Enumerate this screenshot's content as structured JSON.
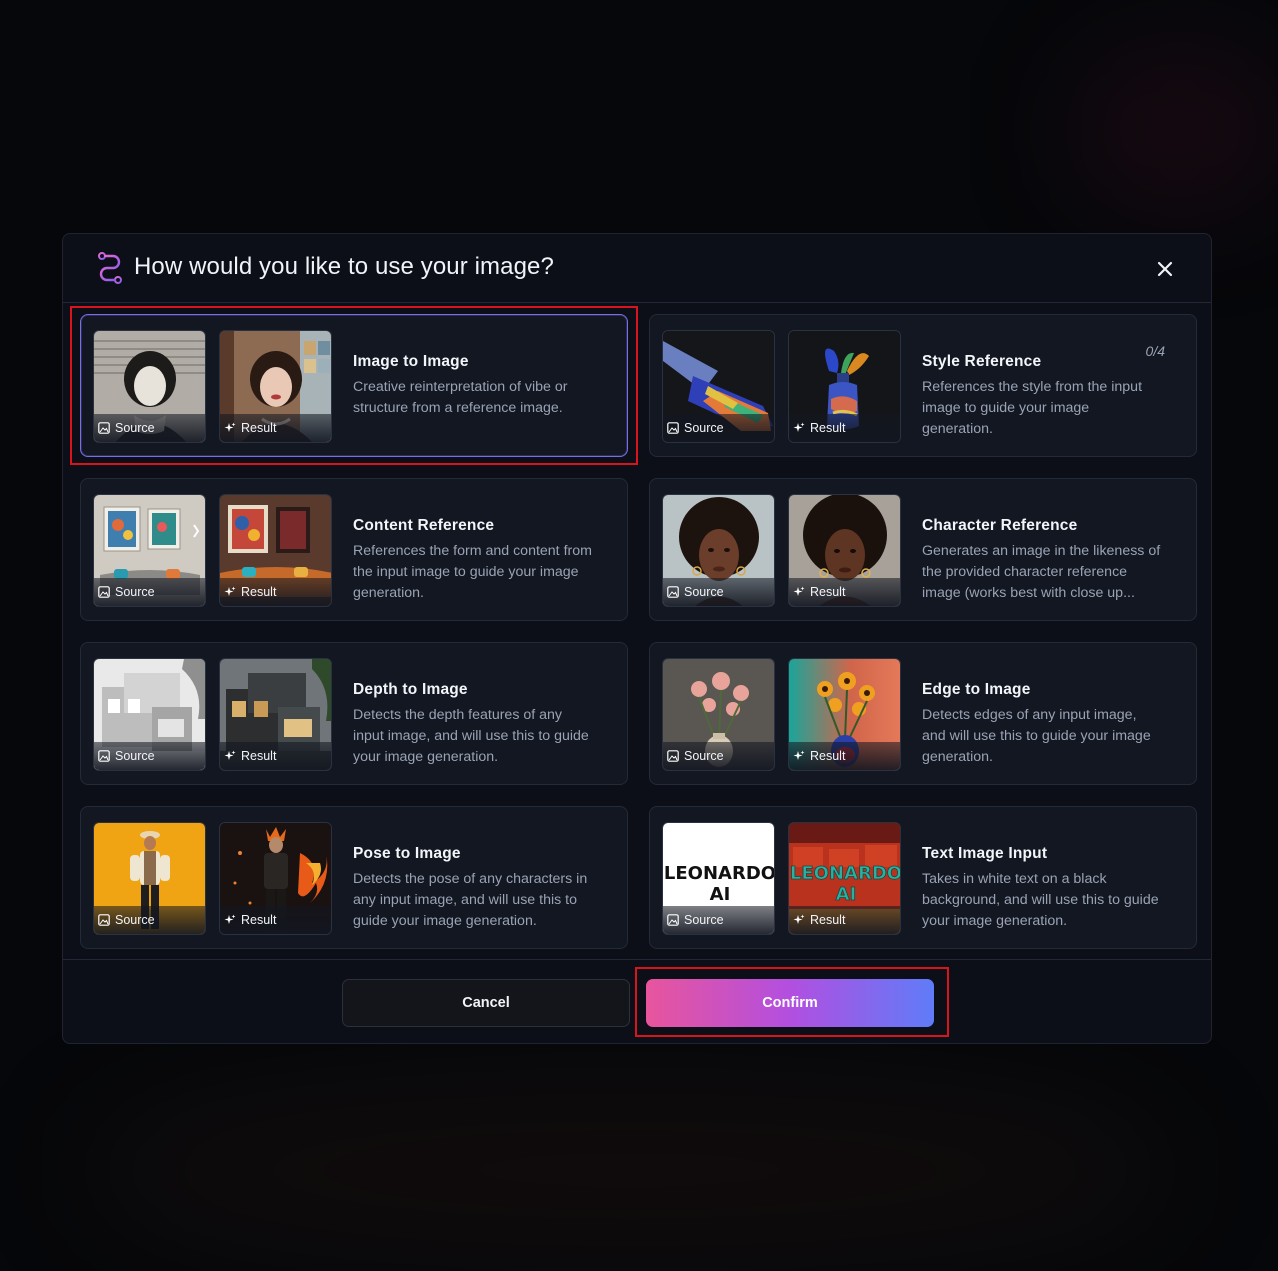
{
  "dialog": {
    "title": "How would you like to use your image?",
    "logo_icon": "leonardo-path-logo-icon",
    "close_icon": "close-icon"
  },
  "labels": {
    "source": "Source",
    "result": "Result"
  },
  "options": [
    {
      "title": "Image to Image",
      "description": "Creative reinterpretation of vibe or structure from a reference image.",
      "selected": true,
      "badge": ""
    },
    {
      "title": "Style Reference",
      "description": "References the style from the input image to guide your image generation.",
      "selected": false,
      "badge": "0/4"
    },
    {
      "title": "Content Reference",
      "description": "References the form and content from the input image to guide your image generation.",
      "selected": false,
      "badge": ""
    },
    {
      "title": "Character Reference",
      "description": "Generates an image in the likeness of the provided character reference image (works best with close up...",
      "selected": false,
      "badge": ""
    },
    {
      "title": "Depth to Image",
      "description": "Detects the depth features of any input image, and will use this to guide your image generation.",
      "selected": false,
      "badge": ""
    },
    {
      "title": "Edge to Image",
      "description": "Detects edges of any input image, and will use this to guide your image generation.",
      "selected": false,
      "badge": ""
    },
    {
      "title": "Pose to Image",
      "description": "Detects the pose of any characters in any input image, and will use this to guide your image generation.",
      "selected": false,
      "badge": ""
    },
    {
      "title": "Text Image Input",
      "description": "Takes in white text on a black background, and will use this to guide your image generation.",
      "selected": false,
      "badge": ""
    }
  ],
  "thumb_text": {
    "line1": "LEONARDO",
    "line2": "AI"
  },
  "footer": {
    "cancel_label": "Cancel",
    "confirm_label": "Confirm"
  },
  "colors": {
    "accent_start": "#e8559c",
    "accent_mid": "#b24fe0",
    "accent_end": "#5f7cf8",
    "selected_border": "#7a6ee8",
    "highlight": "#d8141e"
  }
}
